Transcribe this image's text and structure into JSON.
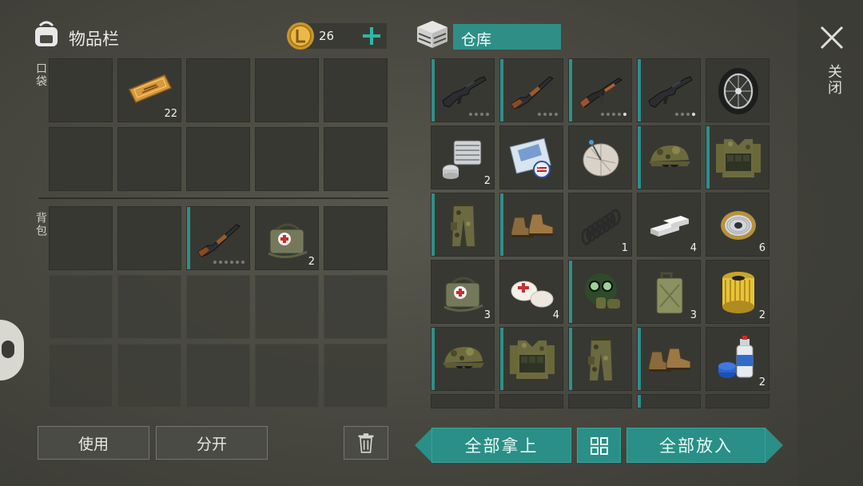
{
  "inventory": {
    "title": "物品栏",
    "coins": "26",
    "pocket_label": "口袋",
    "backpack_label": "背包",
    "pocket_slots": [
      {
        "item": "coupon-icon",
        "count": "22"
      },
      {
        "item": "",
        "count": ""
      },
      {
        "item": "",
        "count": ""
      },
      {
        "item": "",
        "count": ""
      },
      {
        "item": "",
        "count": ""
      },
      {
        "item": "",
        "count": ""
      },
      {
        "item": "",
        "count": ""
      },
      {
        "item": "",
        "count": ""
      },
      {
        "item": "",
        "count": ""
      },
      {
        "item": "",
        "count": ""
      }
    ],
    "backpack_slots": [
      {
        "item": "",
        "count": ""
      },
      {
        "item": "",
        "count": ""
      },
      {
        "item": "shotgun-icon",
        "count": ""
      },
      {
        "item": "medkit-bag-icon",
        "count": "2"
      },
      {
        "item": "",
        "count": ""
      }
    ],
    "use_label": "使用",
    "split_label": "分开"
  },
  "storage": {
    "title": "仓库",
    "close_label": "关闭",
    "slots": [
      {
        "item": "m16-rifle-icon",
        "count": ""
      },
      {
        "item": "pump-shotgun-icon",
        "count": ""
      },
      {
        "item": "ak47-rifle-icon",
        "count": ""
      },
      {
        "item": "m16-rifle-icon",
        "count": ""
      },
      {
        "item": "wheel-icon",
        "count": ""
      },
      {
        "item": "engine-cylinder-icon",
        "count": "2"
      },
      {
        "item": "blueprint-icon",
        "count": ""
      },
      {
        "item": "satellite-dish-icon",
        "count": ""
      },
      {
        "item": "camo-cap-icon",
        "count": ""
      },
      {
        "item": "camo-vest-icon",
        "count": ""
      },
      {
        "item": "camo-pants-icon",
        "count": ""
      },
      {
        "item": "boots-icon",
        "count": ""
      },
      {
        "item": "spring-icon",
        "count": "1"
      },
      {
        "item": "metal-bars-icon",
        "count": "4"
      },
      {
        "item": "wire-spool-icon",
        "count": "6"
      },
      {
        "item": "medkit-bag-icon",
        "count": "3"
      },
      {
        "item": "bandage-icon",
        "count": "4"
      },
      {
        "item": "gas-mask-icon",
        "count": ""
      },
      {
        "item": "jerrycan-icon",
        "count": "3"
      },
      {
        "item": "oil-filter-icon",
        "count": "2"
      },
      {
        "item": "camo-cap-icon",
        "count": ""
      },
      {
        "item": "camo-vest-icon",
        "count": ""
      },
      {
        "item": "camo-pants-icon",
        "count": ""
      },
      {
        "item": "boots-icon",
        "count": ""
      },
      {
        "item": "spray-paint-icon",
        "count": "2"
      }
    ],
    "take_all_label": "全部拿上",
    "put_all_label": "全部放入"
  },
  "colors": {
    "accent": "#2a8f87",
    "slot": "#383833",
    "background": "#4a4a42"
  }
}
